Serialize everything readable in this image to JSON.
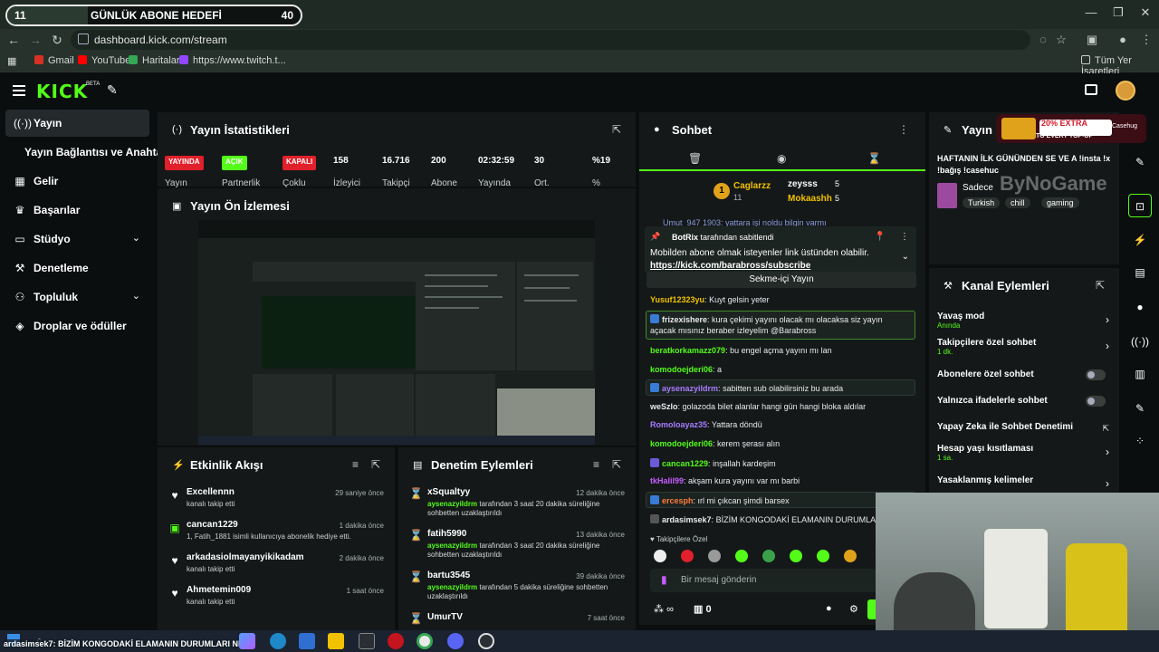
{
  "goal": {
    "current": "11",
    "title": "GÜNLÜK ABONE HEDEFİ",
    "target": "40",
    "progress": 0.275
  },
  "browser": {
    "url": "dashboard.kick.com/stream",
    "bookmarks": [
      "Gmail",
      "YouTube",
      "Haritalar",
      "https://www.twitch.t..."
    ],
    "all_bookmarks": "Tüm Yer İşaretleri"
  },
  "sidebar": {
    "items": [
      {
        "label": "Yayın",
        "icon": "broadcast-icon"
      },
      {
        "label": "Yayın Bağlantısı ve Anahtarı",
        "icon": ""
      },
      {
        "label": "Gelir",
        "icon": "dashboard-icon"
      },
      {
        "label": "Başarılar",
        "icon": "trophy-icon"
      },
      {
        "label": "Stüdyo",
        "icon": "studio-icon"
      },
      {
        "label": "Denetleme",
        "icon": "gavel-icon"
      },
      {
        "label": "Topluluk",
        "icon": "community-icon"
      },
      {
        "label": "Droplar ve ödüller",
        "icon": "gift-icon"
      }
    ]
  },
  "stats": {
    "title": "Yayın İstatistikleri",
    "badges": [
      {
        "label": "YAYINDA",
        "caption": "Yayın",
        "color": "#e0202a"
      },
      {
        "label": "AÇIK",
        "caption": "Partnerlik",
        "color": "#53fc18"
      },
      {
        "label": "KAPALI",
        "caption": "Çoklu",
        "color": "#e0202a"
      }
    ],
    "values": [
      {
        "value": "158",
        "label": "İzleyici"
      },
      {
        "value": "16.716",
        "label": "Takipçi"
      },
      {
        "value": "200",
        "label": "Abone"
      },
      {
        "value": "02:32:59",
        "label": "Yayında"
      },
      {
        "value": "30",
        "label": "Ort."
      },
      {
        "value": "%19",
        "label": "%"
      }
    ]
  },
  "preview": {
    "title": "Yayın Ön İzlemesi"
  },
  "activity": {
    "title": "Etkinlik Akışı",
    "items": [
      {
        "name": "Excellennn",
        "sub": "kanalı takip etti",
        "time": "29 saniye önce",
        "icon": "heart-icon"
      },
      {
        "name": "cancan1229",
        "sub": "1, Fatih_1881 isimli kullanıcıya abonelik hediye etti.",
        "time": "1 dakika önce",
        "icon": "gift-sub-icon"
      },
      {
        "name": "arkadasiolmayanyikikadam",
        "sub": "kanalı takip etti",
        "time": "2 dakika önce",
        "icon": "heart-icon"
      },
      {
        "name": "Ahmetemin009",
        "sub": "kanalı takip etti",
        "time": "1 saat önce",
        "icon": "heart-icon"
      }
    ]
  },
  "moderation": {
    "title": "Denetim Eylemleri",
    "items": [
      {
        "name": "xSqualtyy",
        "mod": "aysenazyildrm",
        "desc": " tarafından 3 saat 20 dakika süreliğine sohbetten uzaklaştırıldı",
        "time": "12 dakika önce"
      },
      {
        "name": "fatih5990",
        "mod": "aysenazyildrm",
        "desc": " tarafından 3 saat 20 dakika süreliğine sohbetten uzaklaştırıldı",
        "time": "13 dakika önce"
      },
      {
        "name": "bartu3545",
        "mod": "aysenazyildrm",
        "desc": " tarafından 5 dakika süreliğine sohbetten uzaklaştırıldı",
        "time": "39 dakika önce"
      },
      {
        "name": "UmurTV",
        "mod": "",
        "desc": "",
        "time": "7 saat önce"
      }
    ]
  },
  "chat": {
    "title": "Sohbet",
    "top_gifter": {
      "rank": "1",
      "name": "Caglarzz",
      "count": "11"
    },
    "gifters": [
      {
        "name": "zeysss",
        "count": "5"
      },
      {
        "name": "Mokaashh",
        "count": "5"
      }
    ],
    "cut_message": "Umut_947 1903: yattara işi noldu bilgin varmı",
    "pinned": {
      "by": "BotRix",
      "by_suffix": "tarafından sabitlendi",
      "text": "Mobilden abone olmak isteyenler link üstünden olabilir.",
      "link": "https://kick.com/barabross/subscribe"
    },
    "popout_button": "Sekme-içi Yayın",
    "messages": [
      {
        "user": "Yusuf12323yu",
        "color": "#f2c200",
        "text": " Kuyt gelsin yeter"
      },
      {
        "user": "frizexishere",
        "color": "#e8eaed",
        "text": " kura çekimi yayını olacak mı olacaksa siz yayın açacak mısınız beraber izleyelim @Barabross",
        "highlight": "green"
      },
      {
        "user": "beratkorkamazz079",
        "color": "#53fc18",
        "text": " bu engel açma yayını mı lan"
      },
      {
        "user": "komodoejderi06",
        "color": "#53fc18",
        "text": " a"
      },
      {
        "user": "aysenazyildrm",
        "color": "#a77bff",
        "text": " sabitten sub olabilirsiniz bu arada",
        "highlight": "plain"
      },
      {
        "user": "weSzlo",
        "color": "#e8eaed",
        "text": " golazoda bilet alanlar hangi gün hangi bloka aldılar"
      },
      {
        "user": "Romoloayaz35",
        "color": "#a77bff",
        "text": " Yattara döndü"
      },
      {
        "user": "komodoejderi06",
        "color": "#53fc18",
        "text": " kerem şerası alın"
      },
      {
        "user": "cancan1229",
        "color": "#53fc18",
        "text": " inşallah kardeşim"
      },
      {
        "user": "tkHalil99",
        "color": "#c65cff",
        "text": " akşam kura yayını var mı barbi"
      },
      {
        "user": "ercesph",
        "color": "#ff7b3a",
        "text": " ırl mi çıkcan şimdi barsex",
        "highlight": "plain"
      },
      {
        "user": "ardasimsek7",
        "color": "#e8eaed",
        "text": " BİZİM KONGODAKİ ELAMANIN DURUMLARI"
      }
    ],
    "followers_only": "Takipçilere Özel",
    "input_placeholder": "Bir mesaj gönderin",
    "points": "∞",
    "gift_count": "0"
  },
  "stream_info": {
    "title": "Yayın b...",
    "headline": "HAFTANIN İLK GÜNÜNDEN SE VE A !insta !x !bağış !casehuc",
    "language_prefix": "Sadece",
    "tags": [
      "Turkish",
      "chill",
      "gaming"
    ]
  },
  "ad": {
    "headline": "20% EXTRA",
    "sub": "TO EVERY TOP-UP",
    "brand": "Casehug"
  },
  "channel_actions": {
    "title": "Kanal Eylemleri",
    "items": [
      {
        "label": "Yavaş mod",
        "sub": "Anında",
        "control": "chevron"
      },
      {
        "label": "Takipçilere özel sohbet",
        "sub": "1 dk.",
        "control": "chevron"
      },
      {
        "label": "Abonelere özel sohbet",
        "sub": "",
        "control": "toggle"
      },
      {
        "label": "Yalnızca ifadelerle sohbet",
        "sub": "",
        "control": "toggle"
      },
      {
        "label": "Yapay Zeka ile Sohbet Denetimi",
        "sub": "",
        "control": "external"
      },
      {
        "label": "Hesap yaşı kısıtlaması",
        "sub": "1 sa.",
        "control": "chevron"
      },
      {
        "label": "Yasaklanmış kelimeler",
        "sub": "",
        "control": "chevron"
      }
    ]
  },
  "taskbar": {
    "ticker": "ardasimsek7: BİZİM KONGODAKİ ELAMANIN DURUMLARI NE"
  },
  "watermark": "ByNoGame"
}
